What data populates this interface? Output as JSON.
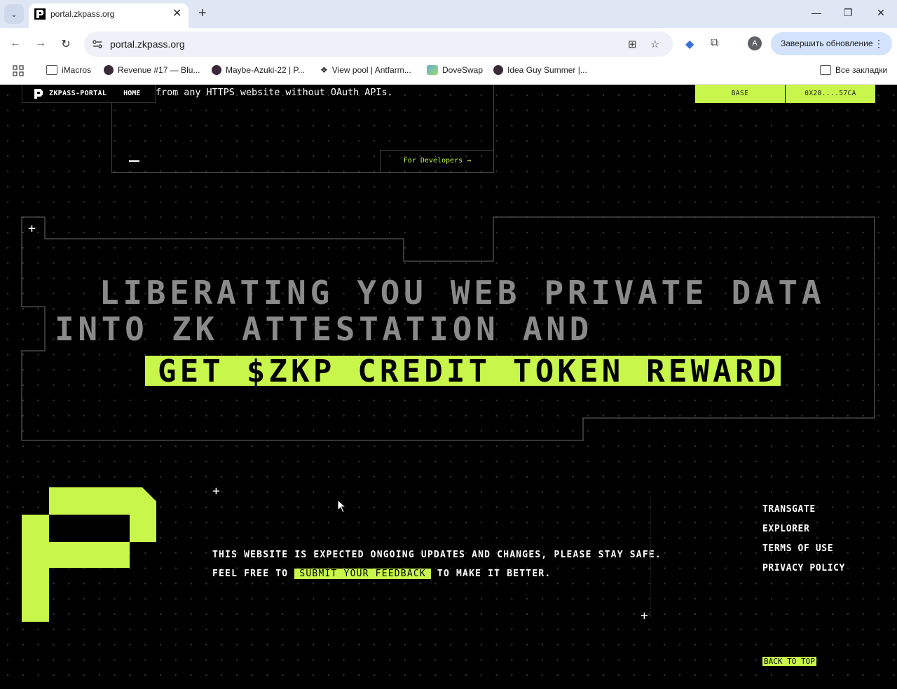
{
  "browser": {
    "tab_title": "portal.zkpass.org",
    "url": "portal.zkpass.org",
    "update_button": "Завершить обновление",
    "avatar_letter": "A",
    "bookmarks": [
      {
        "label": "iMacros"
      },
      {
        "label": "Revenue #17 — Blu..."
      },
      {
        "label": "Maybe-Azuki-22 | P..."
      },
      {
        "label": "View pool | Antfarm..."
      },
      {
        "label": "DoveSwap"
      },
      {
        "label": "Idea Guy Summer |..."
      }
    ],
    "all_bookmarks": "Все закладки"
  },
  "nav": {
    "brand": "ZKPASS-PORTAL",
    "home": "HOME"
  },
  "top_card": {
    "text": "from any HTTPS website without OAuth APIs.",
    "dev_button": "For Developers →"
  },
  "wallet": {
    "network": "BASE",
    "address": "0X28....57CA"
  },
  "hero": {
    "line1": "LIBERATING YOU WEB PRIVATE DATA",
    "line2": "INTO ZK ATTESTATION AND",
    "line3": "GET $ZKP CREDIT TOKEN REWARDS."
  },
  "footer": {
    "msg_line1": "THIS WEBSITE IS EXPECTED ONGOING UPDATES AND CHANGES, PLEASE STAY SAFE.",
    "msg_prefix": "FEEL FREE TO ",
    "feedback_link": "SUBMIT YOUR FEEDBACK",
    "msg_suffix": " TO MAKE IT BETTER.",
    "links": [
      "TRANSGATE",
      "EXPLORER",
      "TERMS OF USE",
      "PRIVACY POLICY"
    ],
    "back_to_top": "BACK TO TOP"
  },
  "colors": {
    "accent": "#c9f64a",
    "background": "#000000",
    "hero_text": "#8a8a8a"
  }
}
